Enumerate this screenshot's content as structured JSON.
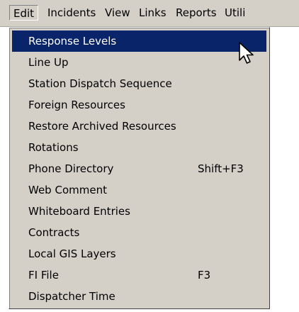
{
  "menubar": {
    "items": [
      {
        "label": "Edit"
      },
      {
        "label": "Incidents"
      },
      {
        "label": "View"
      },
      {
        "label": "Links"
      },
      {
        "label": "Reports"
      },
      {
        "label": "Utili"
      }
    ]
  },
  "dropdown": {
    "items": [
      {
        "label": "Response Levels",
        "shortcut": ""
      },
      {
        "label": "Line Up",
        "shortcut": ""
      },
      {
        "label": "Station Dispatch Sequence",
        "shortcut": ""
      },
      {
        "label": "Foreign Resources",
        "shortcut": ""
      },
      {
        "label": "Restore Archived Resources",
        "shortcut": ""
      },
      {
        "label": "Rotations",
        "shortcut": ""
      },
      {
        "label": "Phone Directory",
        "shortcut": "Shift+F3"
      },
      {
        "label": "Web Comment",
        "shortcut": ""
      },
      {
        "label": "Whiteboard Entries",
        "shortcut": ""
      },
      {
        "label": "Contracts",
        "shortcut": ""
      },
      {
        "label": "Local GIS Layers",
        "shortcut": ""
      },
      {
        "label": "FI File",
        "shortcut": "F3"
      },
      {
        "label": "Dispatcher Time",
        "shortcut": ""
      }
    ]
  },
  "colors": {
    "menu_background": "#d4d0c8",
    "highlight_background": "#0a246a",
    "highlight_text": "#ffffff"
  },
  "cursor": {
    "icon": "arrow-pointer-icon"
  }
}
